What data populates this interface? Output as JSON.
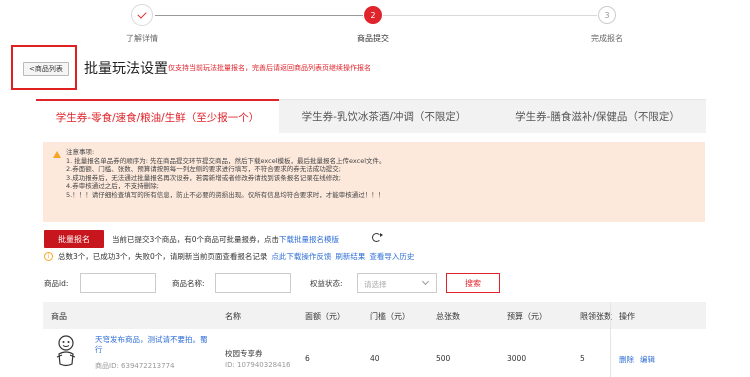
{
  "stepper": {
    "steps": [
      {
        "label": "了解详情",
        "state": "done"
      },
      {
        "label": "商品提交",
        "state": "active",
        "number": "2"
      },
      {
        "label": "完成报名",
        "state": "pending",
        "number": "3"
      }
    ]
  },
  "header": {
    "back_label": "<商品列表",
    "title": "批量玩法设置",
    "hint": "仅支持当前玩法批量报名，完善后请返回商品列表页继续操作报名"
  },
  "tabs": [
    {
      "label": "学生券-零食/速食/粮油/生鲜（至少报一个）",
      "active": true
    },
    {
      "label": "学生券-乳饮冰茶酒/冲调（不限定）",
      "active": false
    },
    {
      "label": "学生券-膳食滋补/保健品（不限定）",
      "active": false
    }
  ],
  "notice": {
    "title": "注意事项:",
    "lines": [
      "1. 批量报名单品券的顺序为: 先在商品提交环节提交商品，然后下载excel模板，最后批量报名上传excel文件。",
      "2.券面额、门槛、张数、预算请按照每一列左侧的要求进行填写，不符合要求的券无法成功提交;",
      "3.成功报券后，无法通过批量报名再次设券，若需新增或者修改券请找到该条报名记录在线修改;",
      "4.券审核通过之后，不支持删除;",
      "5.！！！请仔细检查填写的所有信息，防止不必要的资损出现。仅所有信息均符合要求时，才能审核通过！！！"
    ]
  },
  "actions": {
    "batch_button": "批量报名",
    "submitted_text": "当前已提交3个商品，有0个商品可批量报券，点击",
    "download_link": "下载批量报名模版"
  },
  "summary": {
    "text": "总数3个，已成功3个，失败0个，请刷新当前页面查看报名记录",
    "link_feedback": "点此下载操作反馈",
    "link_refresh": "刷新结果",
    "link_history": "查看导入历史"
  },
  "filters": {
    "product_id_label": "商品id:",
    "product_name_label": "商品名称:",
    "status_label": "权益状态:",
    "status_placeholder": "请选择",
    "search_button": "搜索"
  },
  "table": {
    "headers": [
      "商品",
      "名称",
      "面额（元）",
      "门槛（元）",
      "总张数",
      "预算（元）",
      "限领张数",
      "操作"
    ],
    "rows": [
      {
        "product_name": "天穹发布商品，测试请不要拍。蜀行",
        "product_id": "商品ID: 639472213774",
        "coupon_name": "校园专享券",
        "coupon_id": "ID: 107940328416",
        "face_value": "6",
        "threshold": "40",
        "total": "500",
        "budget": "3000",
        "limit": "5",
        "op_delete": "删除",
        "op_edit": "编辑"
      }
    ]
  },
  "colors": {
    "accent": "#e0242b",
    "link": "#2f6fd6",
    "notice_bg": "#fde9dc"
  }
}
